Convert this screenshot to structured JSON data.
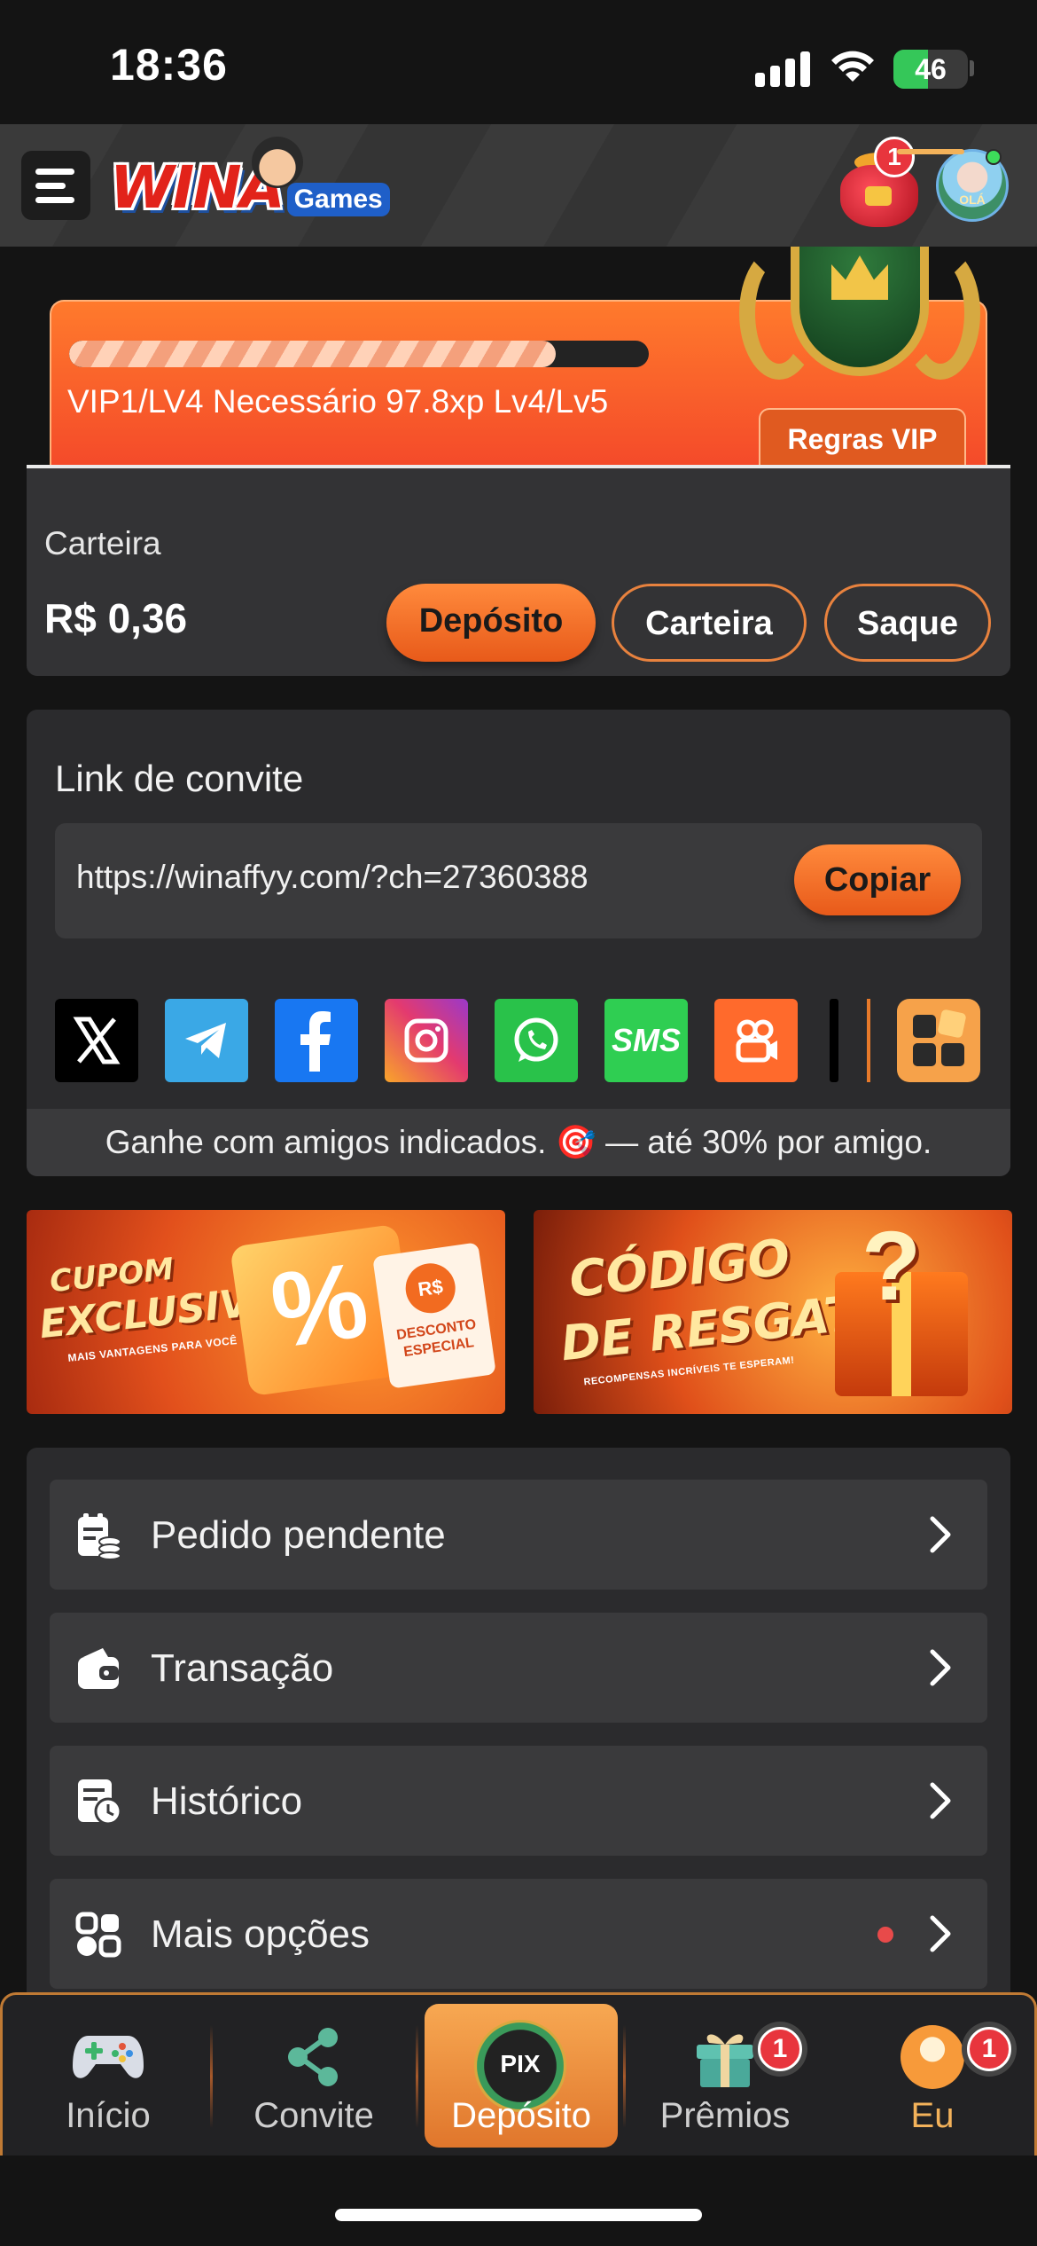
{
  "status_bar": {
    "time": "18:36",
    "battery": "46"
  },
  "header": {
    "logo_main": "WINA",
    "logo_sub": "Games",
    "bag_badge": "1",
    "avatar_text": "OLÁ"
  },
  "vip": {
    "progress_fraction": 0.84,
    "text": "VIP1/LV4 Necessário 97.8xp Lv4/Lv5",
    "rules_label": "Regras VIP"
  },
  "wallet": {
    "label": "Carteira",
    "amount": "R$ 0,36",
    "buttons": {
      "deposit": "Depósito",
      "wallet": "Carteira",
      "withdraw": "Saque"
    }
  },
  "invite": {
    "title": "Link de convite",
    "url": "https://winaffyy.com/?ch=27360388",
    "copy_label": "Copiar",
    "share_icons": [
      "x-icon",
      "telegram-icon",
      "facebook-icon",
      "instagram-icon",
      "whatsapp-icon",
      "sms-icon",
      "kwai-icon",
      "more-apps-icon"
    ],
    "sms_label": "SMS",
    "note": "Ganhe com amigos indicados. 🎯 — até 30% por amigo."
  },
  "banners": {
    "coupon": {
      "line1": "CUPOM",
      "line2": "EXCLUSIVO",
      "sub": "MAIS VANTAGENS PARA VOCÊ",
      "ticket": "%",
      "coin": "R$",
      "tag": "DESCONTO ESPECIAL"
    },
    "code": {
      "line1": "CÓDIGO",
      "line2": "DE RESGATE",
      "sub": "RECOMPENSAS INCRÍVEIS TE ESPERAM!",
      "mark": "?"
    }
  },
  "menu": {
    "items": [
      {
        "label": "Pedido pendente",
        "icon": "pending-order-icon"
      },
      {
        "label": "Transação",
        "icon": "wallet-icon"
      },
      {
        "label": "Histórico",
        "icon": "history-icon"
      },
      {
        "label": "Mais opções",
        "icon": "more-options-icon"
      }
    ]
  },
  "bottom_nav": {
    "items": [
      {
        "label": "Início",
        "icon": "gamepad-icon"
      },
      {
        "label": "Convite",
        "icon": "share-icon"
      },
      {
        "label": "Depósito",
        "icon": "pix-icon",
        "icon_text": "PIX",
        "active": true
      },
      {
        "label": "Prêmios",
        "icon": "gift-icon",
        "badge": "1"
      },
      {
        "label": "Eu",
        "icon": "profile-icon",
        "badge": "1"
      }
    ]
  },
  "colors": {
    "accent": "#ff7a2c",
    "background": "#141414",
    "card": "#2b2b2d",
    "active_nav": "#f3b25a"
  }
}
